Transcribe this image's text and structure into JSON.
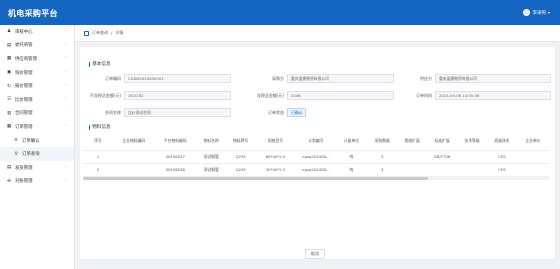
{
  "header": {
    "app_title": "机电采购平台",
    "user_name": "李采购"
  },
  "sidebar": {
    "items": [
      {
        "label": "审核中心",
        "icon": "user-icon",
        "glyph": "♟"
      },
      {
        "label": "委托商管",
        "icon": "document-icon",
        "glyph": "▤"
      },
      {
        "label": "供应商管理",
        "icon": "grid-icon",
        "glyph": "▦"
      },
      {
        "label": "询价管理",
        "icon": "inquiry-icon",
        "glyph": "▣"
      },
      {
        "label": "报价管理",
        "icon": "refresh-icon",
        "glyph": "↻"
      },
      {
        "label": "比价管理",
        "icon": "list-icon",
        "glyph": "☰"
      },
      {
        "label": "合同管理",
        "icon": "contract-icon",
        "glyph": "▥"
      },
      {
        "label": "订单管理",
        "icon": "order-icon",
        "glyph": "▦"
      },
      {
        "label": "订单确认",
        "icon": "check-list-icon",
        "glyph": "≡",
        "sub": true
      },
      {
        "label": "订单查询",
        "icon": "search-icon",
        "glyph": "⚲",
        "sub": true
      },
      {
        "label": "发货管理",
        "icon": "delivery-icon",
        "glyph": "▤"
      },
      {
        "label": "对账管理",
        "icon": "reconcile-icon",
        "glyph": "✣"
      }
    ]
  },
  "breadcrumb": {
    "parent": "订单查询",
    "separator": "/",
    "current": "详情"
  },
  "basic_info": {
    "title": "基本信息",
    "fields": {
      "order_no": {
        "label": "订单编码",
        "value": "CGDD2024090001"
      },
      "purchaser": {
        "label": "采购方",
        "value": "重庆盈捷物资有限公司"
      },
      "supplier": {
        "label": "供应方",
        "value": "重庆盈捷物资有限公司"
      },
      "amount_excl": {
        "label": "不含税总金额(元)",
        "value": "1810.62"
      },
      "amount_incl": {
        "label": "含税总金额(元)",
        "value": "2046"
      },
      "order_time": {
        "label": "订单时间",
        "value": "2024-09-06 14:55:49"
      },
      "contract": {
        "label": "合同名称",
        "value": "比价测试合同"
      },
      "status": {
        "label": "订单状态",
        "value": "已确认"
      }
    }
  },
  "materials": {
    "title": "物料信息",
    "columns": [
      "序号",
      "企业物料编码",
      "平台物料编码",
      "物料名称",
      "物料牌号",
      "规格型号",
      "计划编号",
      "计量单位",
      "采购数量",
      "图纸扩展",
      "标准扩展",
      "技术等级",
      "质量体系",
      "企业单价"
    ],
    "rows": [
      [
        "1",
        "",
        "00106037",
        "测试钢管",
        "Q235",
        "60*40*2.5",
        "cgxq202408...",
        "吨",
        "5",
        "",
        "GB/T706",
        "",
        "CES",
        ""
      ],
      [
        "2",
        "",
        "00106038",
        "测试钢管",
        "Q235",
        "30*40*2.5",
        "cgxq202408...",
        "吨",
        "4",
        "",
        "",
        "",
        "CES",
        ""
      ]
    ]
  },
  "actions": {
    "cancel": "取消"
  }
}
